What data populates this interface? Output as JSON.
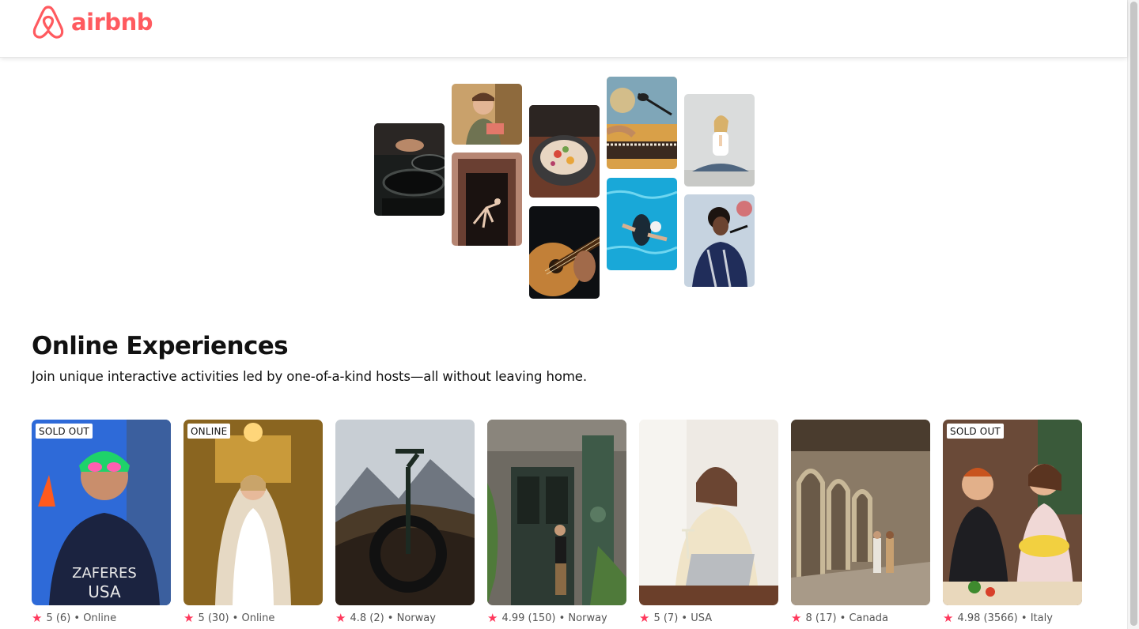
{
  "brand": {
    "name": "airbnb",
    "color": "#FF5A5F",
    "icon": "airbnb-belo-logo-icon"
  },
  "hero": {
    "tiles": [
      {
        "name": "cooking-pans-photo",
        "icon": "frying-pan-photo"
      },
      {
        "name": "host-holding-food-photo",
        "icon": "person-photo"
      },
      {
        "name": "dancer-in-doorway-photo",
        "icon": "dancer-photo"
      },
      {
        "name": "food-bowl-photo",
        "icon": "bowl-photo"
      },
      {
        "name": "guitar-playing-photo",
        "icon": "guitar-photo"
      },
      {
        "name": "singer-microphone-piano-photo",
        "icon": "microphone-photo"
      },
      {
        "name": "swimmer-pool-photo",
        "icon": "swimmer-photo"
      },
      {
        "name": "yoga-meditation-photo",
        "icon": "yoga-photo"
      },
      {
        "name": "singer-performing-photo",
        "icon": "singer-photo"
      }
    ]
  },
  "section": {
    "title": "Online Experiences",
    "subtitle": "Join unique interactive activities led by one-of-a-kind hosts—all without leaving home."
  },
  "cards": [
    {
      "badge": "SOLD OUT",
      "rating": "5",
      "reviews": "(6)",
      "location": "Online",
      "meta": "5 (6) • Online",
      "image": "triathlete-swimmer-photo"
    },
    {
      "badge": "ONLINE",
      "rating": "5",
      "reviews": "(30)",
      "location": "Online",
      "meta": "5 (30) • Online",
      "image": "bride-in-veil-photo"
    },
    {
      "badge": "",
      "rating": "4.8",
      "reviews": "(2)",
      "location": "Norway",
      "meta": "4.8 (2) • Norway",
      "image": "mountain-bike-photo"
    },
    {
      "badge": "",
      "rating": "4.99",
      "reviews": "(150)",
      "location": "Norway",
      "meta": "4.99 (150) • Norway",
      "image": "man-at-green-door-photo"
    },
    {
      "badge": "",
      "rating": "5",
      "reviews": "(7)",
      "location": "USA",
      "meta": "5 (7) • USA",
      "image": "woman-with-wine-laptop-photo"
    },
    {
      "badge": "",
      "rating": "8",
      "reviews": "(17)",
      "location": "Canada",
      "meta": "8 (17) • Canada",
      "image": "couple-in-cloister-photo"
    },
    {
      "badge": "SOLD OUT",
      "rating": "4.98",
      "reviews": "(3566)",
      "location": "Italy",
      "meta": "4.98 (3566) • Italy",
      "image": "pasta-cooking-photo"
    }
  ],
  "colors": {
    "star": "#FF385C",
    "title": "#111111",
    "meta": "#555555"
  }
}
